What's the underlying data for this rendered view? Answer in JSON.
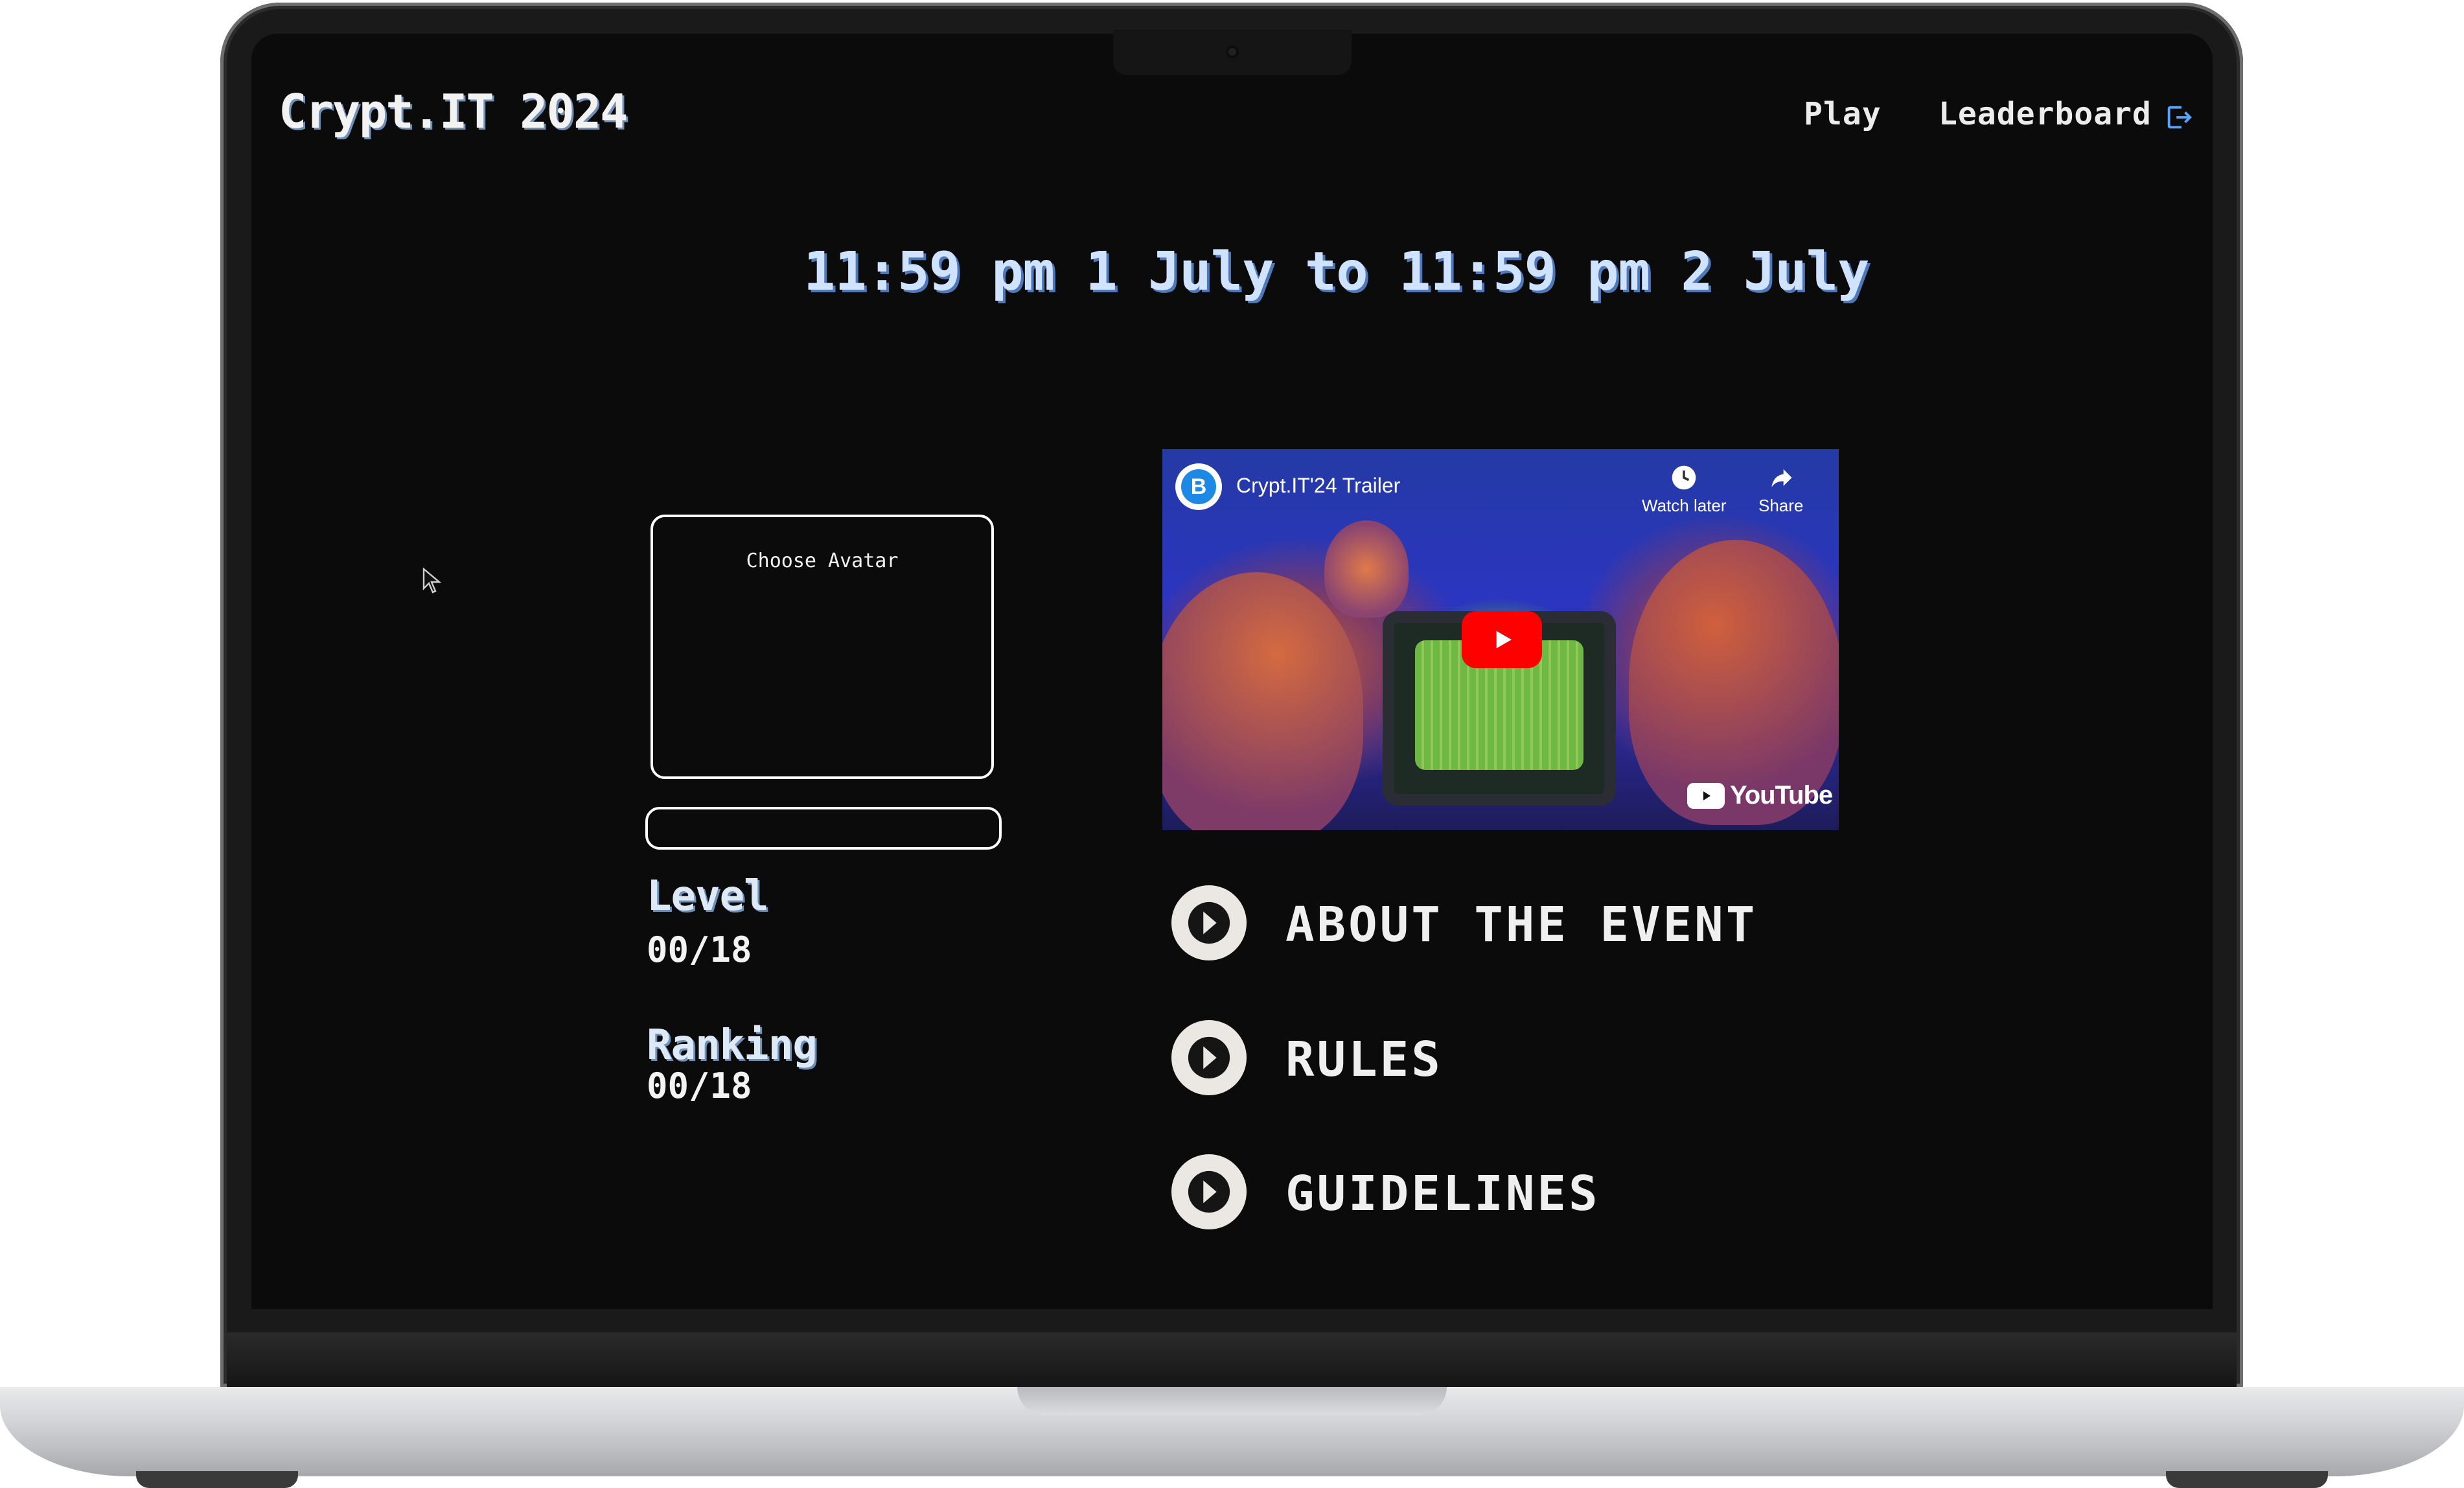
{
  "header": {
    "logo": "Crypt.IT 2024",
    "nav": {
      "play": "Play",
      "leaderboard": "Leaderboard"
    }
  },
  "event": {
    "date_range": "11:59 pm 1 July to 11:59 pm 2 July"
  },
  "profile": {
    "avatar_label": "Choose Avatar",
    "level_title": "Level",
    "level_value": "00/18",
    "ranking_title": "Ranking",
    "ranking_value": "00/18"
  },
  "video": {
    "channel_initial": "B",
    "title": "Crypt.IT'24 Trailer",
    "watch_later": "Watch later",
    "share": "Share",
    "platform": "YouTube"
  },
  "menu": {
    "items": [
      {
        "label": "ABOUT THE EVENT"
      },
      {
        "label": "RULES"
      },
      {
        "label": "GUIDELINES"
      }
    ]
  },
  "colors": {
    "background": "#0b0b0b",
    "accent_shadow": "#4f78b8",
    "youtube_red": "#ff0000",
    "menu_circle": "#ebe7e2"
  },
  "icons": [
    "logout-icon",
    "mouse-cursor-icon",
    "clock-icon",
    "share-arrow-icon",
    "play-icon",
    "chevron-right-icon"
  ]
}
